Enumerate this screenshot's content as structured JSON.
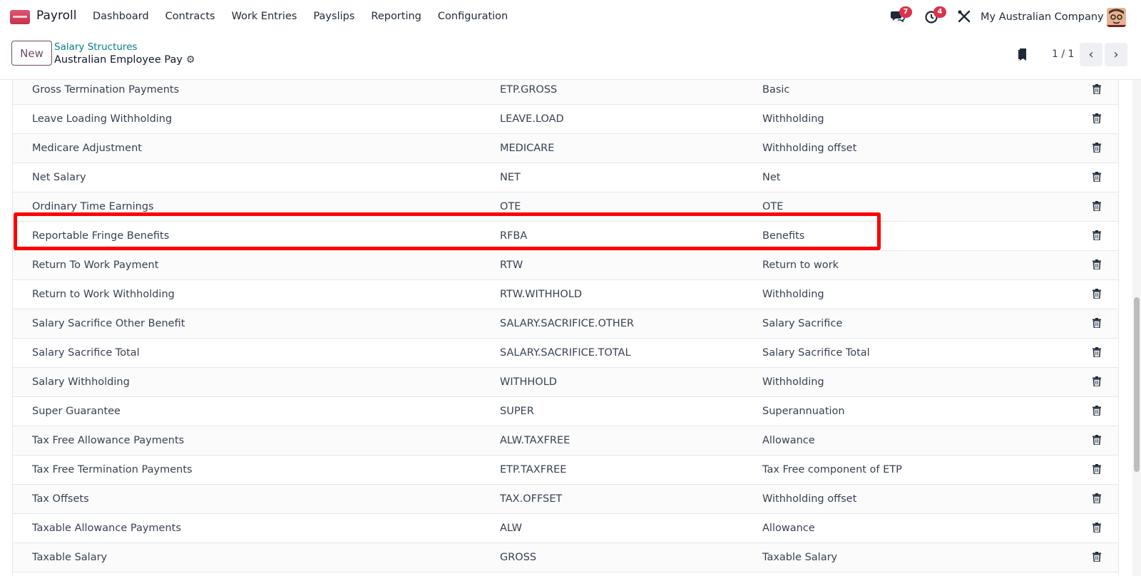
{
  "navbar": {
    "app_name": "Payroll",
    "menu": [
      "Dashboard",
      "Contracts",
      "Work Entries",
      "Payslips",
      "Reporting",
      "Configuration"
    ],
    "messages_badge": "7",
    "activities_badge": "4",
    "company": "My Australian Company",
    "brand_color": "#c2334d",
    "badge_color": "#d9344b"
  },
  "control": {
    "new_label": "New",
    "breadcrumb": "Salary Structures",
    "record_title": "Australian Employee Pay",
    "pager": "1 / 1"
  },
  "rules": [
    {
      "name": "Gross Termination Payments",
      "code": "ETP.GROSS",
      "category": "Basic"
    },
    {
      "name": "Leave Loading Withholding",
      "code": "LEAVE.LOAD",
      "category": "Withholding"
    },
    {
      "name": "Medicare Adjustment",
      "code": "MEDICARE",
      "category": "Withholding offset"
    },
    {
      "name": "Net Salary",
      "code": "NET",
      "category": "Net"
    },
    {
      "name": "Ordinary Time Earnings",
      "code": "OTE",
      "category": "OTE"
    },
    {
      "name": "Reportable Fringe Benefits",
      "code": "RFBA",
      "category": "Benefits"
    },
    {
      "name": "Return To Work Payment",
      "code": "RTW",
      "category": "Return to work"
    },
    {
      "name": "Return to Work Withholding",
      "code": "RTW.WITHHOLD",
      "category": "Withholding"
    },
    {
      "name": "Salary Sacrifice Other Benefit",
      "code": "SALARY.SACRIFICE.OTHER",
      "category": "Salary Sacrifice"
    },
    {
      "name": "Salary Sacrifice Total",
      "code": "SALARY.SACRIFICE.TOTAL",
      "category": "Salary Sacrifice Total"
    },
    {
      "name": "Salary Withholding",
      "code": "WITHHOLD",
      "category": "Withholding"
    },
    {
      "name": "Super Guarantee",
      "code": "SUPER",
      "category": "Superannuation"
    },
    {
      "name": "Tax Free Allowance Payments",
      "code": "ALW.TAXFREE",
      "category": "Allowance"
    },
    {
      "name": "Tax Free Termination Payments",
      "code": "ETP.TAXFREE",
      "category": "Tax Free component of ETP"
    },
    {
      "name": "Tax Offsets",
      "code": "TAX.OFFSET",
      "category": "Withholding offset"
    },
    {
      "name": "Taxable Allowance Payments",
      "code": "ALW",
      "category": "Allowance"
    },
    {
      "name": "Taxable Salary",
      "code": "GROSS",
      "category": "Taxable Salary"
    }
  ],
  "highlight_color": "#ff0000"
}
